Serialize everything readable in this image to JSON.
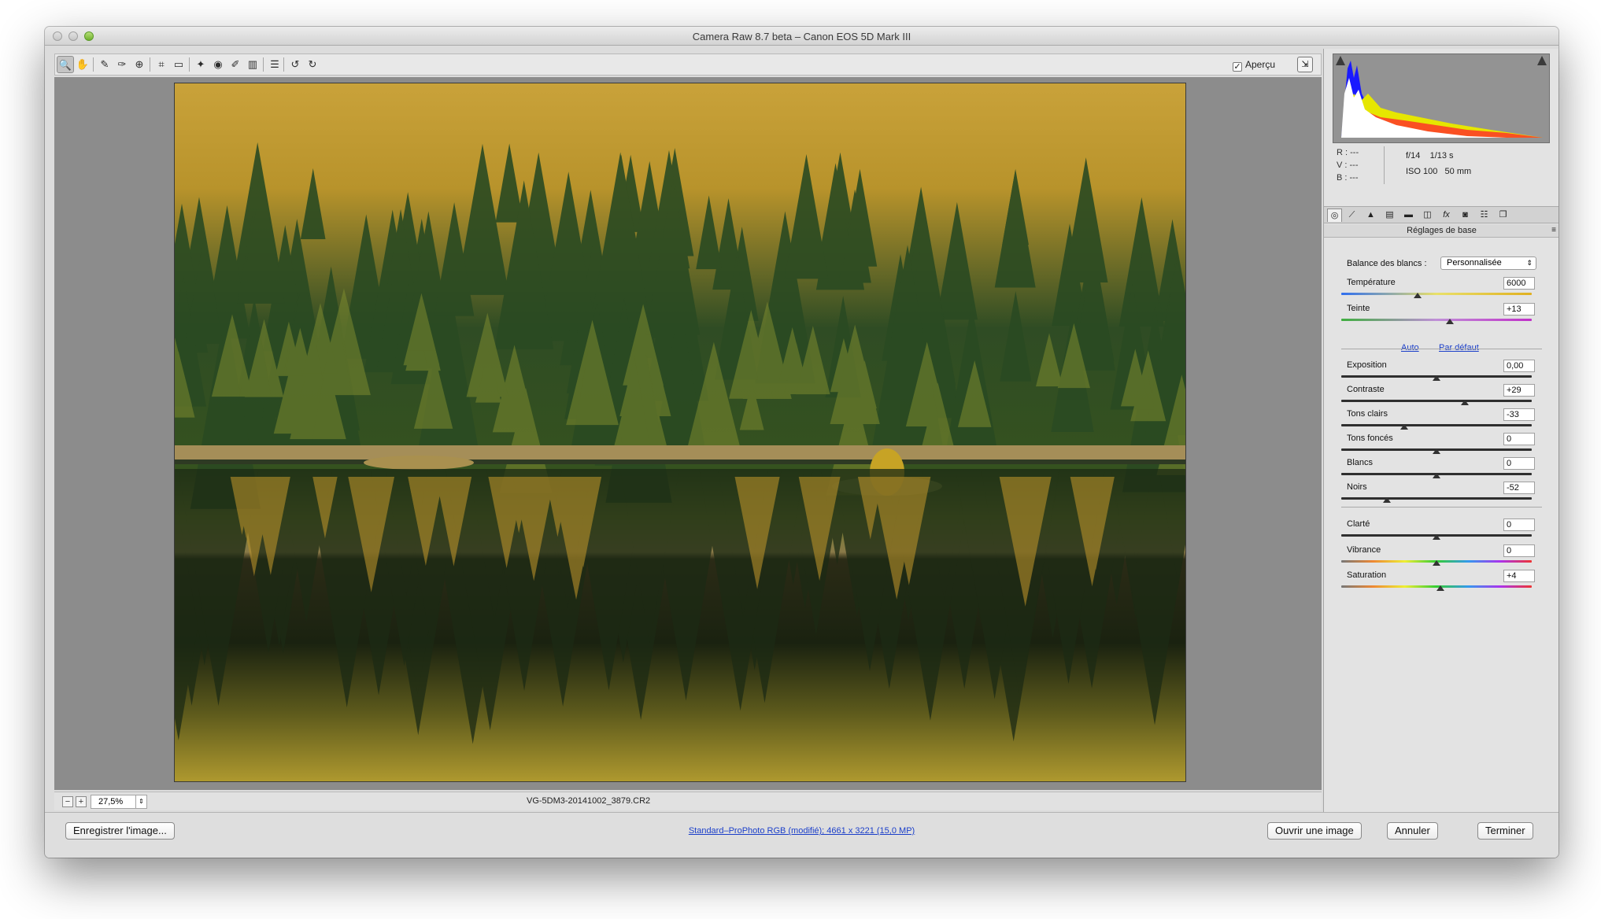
{
  "window": {
    "title": "Camera Raw 8.7 beta  –  Canon EOS 5D Mark III"
  },
  "toolbar": {
    "tools": [
      {
        "name": "zoom-tool-icon",
        "glyph": "🔍"
      },
      {
        "name": "hand-tool-icon",
        "glyph": "✋"
      },
      {
        "name": "white-balance-tool-icon",
        "glyph": "✎"
      },
      {
        "name": "color-sampler-tool-icon",
        "glyph": "✑"
      },
      {
        "name": "targeted-adjustment-tool-icon",
        "glyph": "⊕"
      },
      {
        "name": "crop-tool-icon",
        "glyph": "⌗"
      },
      {
        "name": "straighten-tool-icon",
        "glyph": "▭"
      },
      {
        "name": "spot-removal-tool-icon",
        "glyph": "✦"
      },
      {
        "name": "red-eye-tool-icon",
        "glyph": "◉"
      },
      {
        "name": "adjustment-brush-icon",
        "glyph": "✐"
      },
      {
        "name": "graduated-filter-icon",
        "glyph": "▥"
      },
      {
        "name": "preferences-icon",
        "glyph": "☰"
      },
      {
        "name": "rotate-left-icon",
        "glyph": "↺"
      },
      {
        "name": "rotate-right-icon",
        "glyph": "↻"
      }
    ],
    "preview_label": "Aperçu",
    "preview_checked": "✓"
  },
  "status": {
    "zoom": "27,5%",
    "zoom_out": "−",
    "zoom_in": "+",
    "filename": "VG-5DM3-20141002_3879.CR2"
  },
  "bottom": {
    "save_label": "Enregistrer l'image...",
    "workflow_link": "Standard–ProPhoto RGB (modifié); 4661 x 3221 (15,0 MP)",
    "open_label": "Ouvrir une image",
    "cancel_label": "Annuler",
    "done_label": "Terminer"
  },
  "info": {
    "r": "R :  ---",
    "v": "V :  ---",
    "b": "B :  ---",
    "aperture": "f/14",
    "shutter": "1/13 s",
    "iso": "ISO 100",
    "focal": "50 mm"
  },
  "panel": {
    "section_title": "Réglages de base",
    "wb_label": "Balance des blancs :",
    "wb_value": "Personnalisée",
    "auto_link": "Auto",
    "default_link": "Par défaut",
    "sliders": [
      {
        "label": "Température",
        "value": "6000",
        "pos": 0.4,
        "track": "temp"
      },
      {
        "label": "Teinte",
        "value": "+13",
        "pos": 0.57,
        "track": "tint"
      },
      {
        "label": "Exposition",
        "value": "0,00",
        "pos": 0.5,
        "track": "plain"
      },
      {
        "label": "Contraste",
        "value": "+29",
        "pos": 0.65,
        "track": "plain"
      },
      {
        "label": "Tons clairs",
        "value": "-33",
        "pos": 0.33,
        "track": "plain"
      },
      {
        "label": "Tons foncés",
        "value": "0",
        "pos": 0.5,
        "track": "plain"
      },
      {
        "label": "Blancs",
        "value": "0",
        "pos": 0.5,
        "track": "plain"
      },
      {
        "label": "Noirs",
        "value": "-52",
        "pos": 0.24,
        "track": "plain"
      },
      {
        "label": "Clarté",
        "value": "0",
        "pos": 0.5,
        "track": "plain"
      },
      {
        "label": "Vibrance",
        "value": "0",
        "pos": 0.5,
        "track": "hue"
      },
      {
        "label": "Saturation",
        "value": "+4",
        "pos": 0.52,
        "track": "hue"
      }
    ]
  },
  "colors": {
    "link": "#1a3ec9",
    "canvas_bg": "#8c8c8c",
    "histogram_bg": "#939393"
  }
}
